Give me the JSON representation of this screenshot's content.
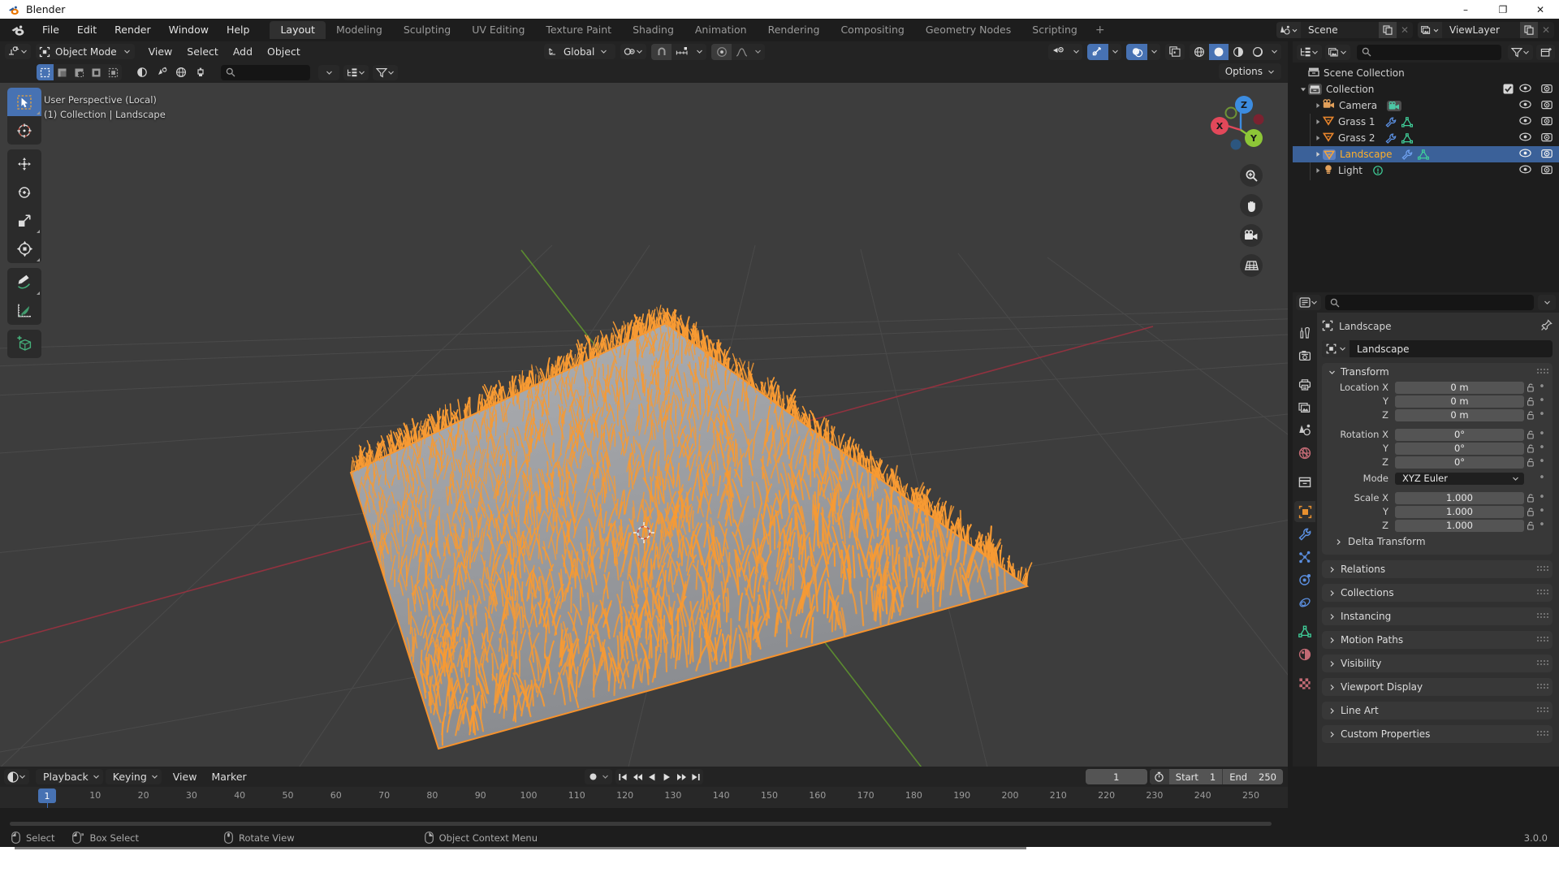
{
  "window": {
    "title": "Blender",
    "logo_icon": "blender-logo-icon",
    "minimize_label": "–",
    "maximize_label": "❐",
    "close_label": "✕"
  },
  "topbar": {
    "app_icon": "blender-menu-icon",
    "menus": [
      "File",
      "Edit",
      "Render",
      "Window",
      "Help"
    ],
    "workspaces": [
      {
        "label": "Layout",
        "active": true
      },
      {
        "label": "Modeling",
        "active": false
      },
      {
        "label": "Sculpting",
        "active": false
      },
      {
        "label": "UV Editing",
        "active": false
      },
      {
        "label": "Texture Paint",
        "active": false
      },
      {
        "label": "Shading",
        "active": false
      },
      {
        "label": "Animation",
        "active": false
      },
      {
        "label": "Rendering",
        "active": false
      },
      {
        "label": "Compositing",
        "active": false
      },
      {
        "label": "Geometry Nodes",
        "active": false
      },
      {
        "label": "Scripting",
        "active": false
      }
    ],
    "add_workspace_label": "+",
    "scene": {
      "icon": "scene-icon",
      "name": "Scene",
      "new_label": "new-scene-icon",
      "unlink_label": "✕"
    },
    "view_layer": {
      "icon": "view-layer-icon",
      "name": "ViewLayer",
      "new_label": "new-viewlayer-icon",
      "unlink_label": "✕"
    }
  },
  "viewport_header": {
    "editor_type_icon": "editor-type-3dview-icon",
    "mode": "Object Mode",
    "mode_icon": "object-mode-icon",
    "menus": [
      "View",
      "Select",
      "Add",
      "Object"
    ],
    "select_modes": [
      "set-select",
      "extend-select",
      "subtract-select",
      "invert-select",
      "intersect-select"
    ],
    "transform_orientation": "Global",
    "orientation_icon": "orientation-gizmo-icon",
    "pivot_icon": "pivot-point-icon",
    "snap_icon": "snap-magnet-icon",
    "snap_to_icon": "snap-increment-icon",
    "proportional_icon": "proportional-edit-icon",
    "falloff_icon": "proportional-falloff-icon",
    "overlay_icon": "show-overlays-icon",
    "gizmo_icon": "show-gizmo-icon",
    "xray_icon": "toggle-xray-icon",
    "shading_modes": [
      "wireframe",
      "solid",
      "material-preview",
      "rendered"
    ],
    "active_shading_mode": "solid",
    "options_label": "Options"
  },
  "viewport_header_row2": {
    "mode_icons": [
      "vertex-select",
      "edge-select",
      "face-select",
      "world-select",
      "brush-select"
    ],
    "search_placeholder": "",
    "search_icon": "search-icon",
    "filter_icon": "filter-icon",
    "sort_icon": "sort-icon"
  },
  "viewport": {
    "info_line1": "User Perspective (Local)",
    "info_line2": "(1) Collection | Landscape",
    "background_color": "#3d3d3d",
    "grid_color": "#4e4e4e",
    "axis_x_color": "#9c3a47",
    "axis_y_color": "#5a8a2f",
    "object_surface_color": "#9ea0a4",
    "selected_outline_color": "#f7922b",
    "grass_color": "#f79a33",
    "toolbar": [
      {
        "name": "tweak-tool",
        "icon": "cursor-arrow-icon",
        "active": true
      },
      {
        "name": "cursor-tool",
        "icon": "3d-cursor-icon",
        "active": false
      },
      {
        "name": "move-tool",
        "icon": "move-arrows-icon",
        "active": false
      },
      {
        "name": "rotate-tool",
        "icon": "rotate-icon",
        "active": false
      },
      {
        "name": "scale-tool",
        "icon": "scale-icon",
        "active": false
      },
      {
        "name": "transform-tool",
        "icon": "transform-icon",
        "active": false
      },
      {
        "name": "annotate-tool",
        "icon": "pencil-icon",
        "active": false
      },
      {
        "name": "measure-tool",
        "icon": "ruler-icon",
        "active": false
      },
      {
        "name": "add-cube-tool",
        "icon": "add-cube-icon",
        "active": false
      }
    ],
    "gizmo": {
      "axes": [
        "X",
        "Y",
        "Z"
      ],
      "x_color": "#e2485a",
      "y_color": "#8dc637",
      "z_color": "#3c8ce0"
    },
    "nav_buttons": [
      {
        "name": "zoom-view-button",
        "icon": "magnifier-icon"
      },
      {
        "name": "pan-view-button",
        "icon": "hand-icon"
      },
      {
        "name": "camera-view-button",
        "icon": "camera-icon"
      },
      {
        "name": "toggle-perspective-button",
        "icon": "grid-perspective-icon"
      }
    ]
  },
  "outliner": {
    "display_mode_icon": "outliner-display-mode-icon",
    "filter_id_icon": "id-type-icon",
    "search_placeholder": "",
    "search_icon": "search-icon",
    "filter_icon": "filter-funnel-icon",
    "new_collection_icon": "new-collection-icon",
    "root": {
      "label": "Scene Collection",
      "icon": "scene-collection-icon"
    },
    "collection": {
      "label": "Collection",
      "icon": "collection-icon",
      "checked": true
    },
    "items": [
      {
        "label": "Camera",
        "icon": "camera-data-icon",
        "icon_color": "#e2a05a",
        "badges": [
          {
            "name": "camera-data-badge",
            "color": "#4dc8a6"
          }
        ],
        "selected": false
      },
      {
        "label": "Grass 1",
        "icon": "mesh-object-icon",
        "icon_color": "#e8852c",
        "badges": [
          {
            "name": "modifier-wrench-badge",
            "color": "#5b8fe0"
          },
          {
            "name": "mesh-data-badge",
            "color": "#3fd09a"
          }
        ],
        "selected": false
      },
      {
        "label": "Grass 2",
        "icon": "mesh-object-icon",
        "icon_color": "#e8852c",
        "badges": [
          {
            "name": "modifier-wrench-badge",
            "color": "#5b8fe0"
          },
          {
            "name": "mesh-data-badge",
            "color": "#3fd09a"
          }
        ],
        "selected": false
      },
      {
        "label": "Landscape",
        "icon": "mesh-object-icon",
        "icon_color": "#f2a33c",
        "badges": [
          {
            "name": "modifier-wrench-badge",
            "color": "#5b8fe0"
          },
          {
            "name": "mesh-data-badge",
            "color": "#3fd09a"
          }
        ],
        "selected": true
      },
      {
        "label": "Light",
        "icon": "light-object-icon",
        "icon_color": "#e2a05a",
        "badges": [
          {
            "name": "light-data-badge",
            "color": "#3fd09a"
          }
        ],
        "selected": false
      }
    ],
    "row_icons": {
      "hide": "eye-icon",
      "disable_render": "camera-render-icon"
    }
  },
  "properties": {
    "search_placeholder": "",
    "search_icon": "search-icon",
    "editor_icon": "properties-editor-icon",
    "options_icon": "chevron-down-icon",
    "breadcrumb": "Landscape",
    "breadcrumb_icon": "object-icon",
    "pin_icon": "pin-icon",
    "object_name": "Landscape",
    "object_name_icon": "object-icon",
    "tabs": [
      {
        "name": "tool-tab",
        "icon": "tool-screwdriver-wrench-icon",
        "active": false,
        "color": "#c8c8c8"
      },
      {
        "name": "render-tab",
        "icon": "render-camera-back-icon",
        "active": false,
        "color": "#c8c8c8"
      },
      {
        "name": "output-tab",
        "icon": "output-printer-icon",
        "active": false,
        "color": "#c8c8c8"
      },
      {
        "name": "view-layer-tab",
        "icon": "view-layer-images-icon",
        "active": false,
        "color": "#c8c8c8"
      },
      {
        "name": "scene-tab",
        "icon": "scene-cone-icon",
        "active": false,
        "color": "#c8c8c8"
      },
      {
        "name": "world-tab",
        "icon": "world-globe-icon",
        "active": false,
        "color": "#c26a74"
      },
      {
        "name": "collection-tab",
        "icon": "collection-box-icon",
        "active": false,
        "color": "#c8c8c8"
      },
      {
        "name": "object-tab",
        "icon": "object-square-icon",
        "active": true,
        "color": "#e8902f"
      },
      {
        "name": "modifiers-tab",
        "icon": "wrench-icon",
        "active": false,
        "color": "#5b8fe0"
      },
      {
        "name": "particles-tab",
        "icon": "particles-icon",
        "active": false,
        "color": "#5b8fe0"
      },
      {
        "name": "physics-tab",
        "icon": "physics-orbit-icon",
        "active": false,
        "color": "#5b8fe0"
      },
      {
        "name": "constraints-tab",
        "icon": "constraints-icon",
        "active": false,
        "color": "#5b8fe0"
      },
      {
        "name": "data-tab",
        "icon": "mesh-data-triangle-icon",
        "active": false,
        "color": "#3fd09a"
      },
      {
        "name": "material-tab",
        "icon": "material-sphere-icon",
        "active": false,
        "color": "#c26a74"
      },
      {
        "name": "texture-tab",
        "icon": "texture-checker-icon",
        "active": false,
        "color": "#c26a74"
      }
    ],
    "transform": {
      "title": "Transform",
      "rows": [
        {
          "label": "Location X",
          "value": "0 m",
          "lock_icon": "unlocked-icon",
          "anim_icon": "animate-dot-icon"
        },
        {
          "label": "Y",
          "value": "0 m",
          "lock_icon": "unlocked-icon",
          "anim_icon": "animate-dot-icon"
        },
        {
          "label": "Z",
          "value": "0 m",
          "lock_icon": "unlocked-icon",
          "anim_icon": "animate-dot-icon"
        },
        {
          "label": "Rotation X",
          "value": "0°",
          "lock_icon": "unlocked-icon",
          "anim_icon": "animate-dot-icon"
        },
        {
          "label": "Y",
          "value": "0°",
          "lock_icon": "unlocked-icon",
          "anim_icon": "animate-dot-icon"
        },
        {
          "label": "Z",
          "value": "0°",
          "lock_icon": "unlocked-icon",
          "anim_icon": "animate-dot-icon"
        }
      ],
      "mode_label": "Mode",
      "mode_value": "XYZ Euler",
      "scale_rows": [
        {
          "label": "Scale X",
          "value": "1.000",
          "lock_icon": "unlocked-icon",
          "anim_icon": "animate-dot-icon"
        },
        {
          "label": "Y",
          "value": "1.000",
          "lock_icon": "unlocked-icon",
          "anim_icon": "animate-dot-icon"
        },
        {
          "label": "Z",
          "value": "1.000",
          "lock_icon": "unlocked-icon",
          "anim_icon": "animate-dot-icon"
        }
      ],
      "delta_label": "Delta Transform"
    },
    "collapsed_panels": [
      "Relations",
      "Collections",
      "Instancing",
      "Motion Paths",
      "Visibility",
      "Viewport Display",
      "Line Art",
      "Custom Properties"
    ]
  },
  "timeline": {
    "editor_icon": "timeline-editor-icon",
    "menus": [
      "Playback",
      "Keying",
      "View",
      "Marker"
    ],
    "record_icon": "auto-keying-record-icon",
    "transport": [
      {
        "name": "jump-to-start-button",
        "icon": "jump-start-icon"
      },
      {
        "name": "previous-keyframe-button",
        "icon": "prev-keyframe-icon"
      },
      {
        "name": "play-reverse-button",
        "icon": "play-reverse-icon"
      },
      {
        "name": "play-button",
        "icon": "play-icon"
      },
      {
        "name": "next-keyframe-button",
        "icon": "next-keyframe-icon"
      },
      {
        "name": "jump-to-end-button",
        "icon": "jump-end-icon"
      }
    ],
    "current_frame": "1",
    "clock_icon": "use-preview-range-icon",
    "start_label": "Start",
    "start_value": "1",
    "end_label": "End",
    "end_value": "250",
    "ticks": [
      10,
      20,
      30,
      40,
      50,
      60,
      70,
      80,
      90,
      100,
      110,
      120,
      130,
      140,
      150,
      160,
      170,
      180,
      190,
      200,
      210,
      220,
      230,
      240,
      250
    ],
    "playhead_frame": "1"
  },
  "statusbar": {
    "items": [
      {
        "icon": "mouse-left-icon",
        "label": "Select"
      },
      {
        "icon": "mouse-left-drag-icon",
        "label": "Box Select"
      },
      {
        "icon": "mouse-middle-icon",
        "label": "Rotate View"
      },
      {
        "icon": "mouse-right-icon",
        "label": "Object Context Menu"
      }
    ],
    "version": "3.0.0"
  }
}
